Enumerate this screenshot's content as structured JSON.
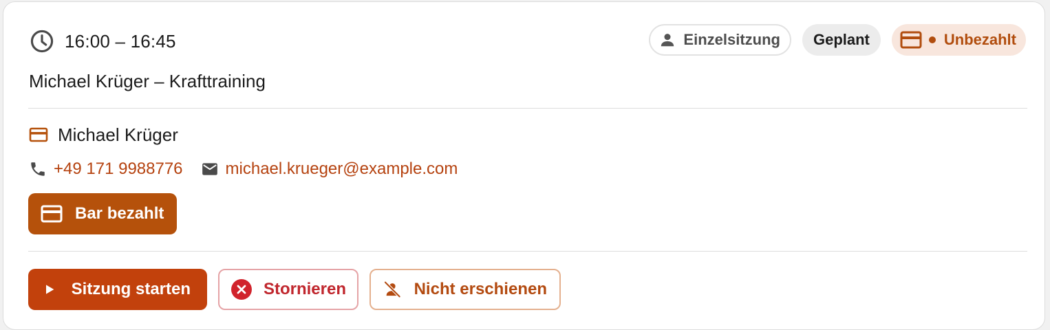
{
  "session": {
    "time_range": "16:00 – 16:45",
    "title": "Michael Krüger – Krafttraining"
  },
  "badges": {
    "type_label": "Einzelsitzung",
    "status_label": "Geplant",
    "payment_label": "Unbezahlt"
  },
  "client": {
    "name": "Michael Krüger",
    "phone": "+49 171 9988776",
    "email": "michael.krueger@example.com"
  },
  "actions": {
    "paid_cash_label": "Bar bezahlt",
    "start_label": "Sitzung starten",
    "cancel_label": "Stornieren",
    "no_show_label": "Nicht erschienen"
  },
  "icons": {
    "time": "clock-icon",
    "type": "person-icon",
    "payment": "credit-card-icon",
    "phone": "phone-icon",
    "email": "mail-icon",
    "start": "play-icon",
    "cancel": "cancel-circle-icon",
    "no_show": "person-off-icon"
  },
  "colors": {
    "accent": "#c2410c",
    "paid_button": "#b5510b",
    "unpaid_badge_bg": "#f8e6dd",
    "unpaid_badge_text": "#b14d0e",
    "cancel": "#c0262d",
    "link": "#b5420f"
  }
}
